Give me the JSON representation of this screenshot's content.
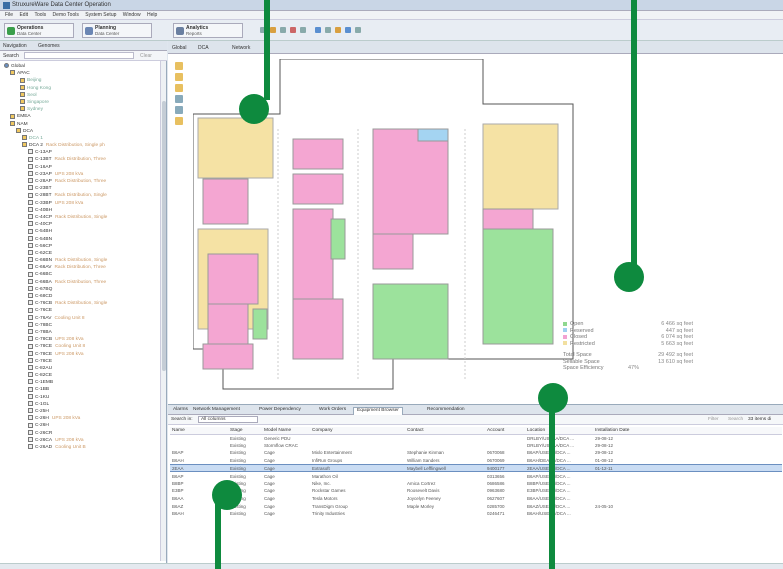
{
  "window": {
    "title": "StruxureWare Data Center Operation"
  },
  "menu": [
    "File",
    "Edit",
    "Tools",
    "Demo Tools",
    "System Setup",
    "Window",
    "Help"
  ],
  "perspectives": [
    {
      "title": "Operations",
      "subtitle": "Data Center"
    },
    {
      "title": "Planning",
      "subtitle": "Data Center"
    },
    {
      "title": "Analytics",
      "subtitle": "Reports"
    }
  ],
  "left_tabs": [
    "Navigation",
    "Genomes"
  ],
  "search_label": "Search",
  "clear_label": "Clear",
  "tree": [
    {
      "label": "Global",
      "extra": "",
      "c": ""
    },
    {
      "label": "APAC",
      "extra": "",
      "c": ""
    },
    {
      "label": "Beijing",
      "extra": "",
      "c": "g"
    },
    {
      "label": "Hong Kong",
      "extra": "",
      "c": "g"
    },
    {
      "label": "Seol",
      "extra": "",
      "c": "g"
    },
    {
      "label": "Singapore",
      "extra": "",
      "c": "g"
    },
    {
      "label": "Sydney",
      "extra": "",
      "c": "g"
    },
    {
      "label": "EMEA",
      "extra": "",
      "c": ""
    },
    {
      "label": "NAM",
      "extra": "",
      "c": ""
    },
    {
      "label": "DCA",
      "extra": "",
      "c": ""
    },
    {
      "label": "DCA 1",
      "extra": "",
      "c": "g"
    },
    {
      "label": "DCA 2",
      "extra": "Rack Distribution, Single ph",
      "c": ""
    },
    {
      "label": "C-13AP",
      "extra": "",
      "c": ""
    },
    {
      "label": "C-13BT",
      "extra": "Rack Distribution, Three",
      "c": ""
    },
    {
      "label": "C-16AP",
      "extra": "",
      "c": ""
    },
    {
      "label": "C-23AP",
      "extra": "UPS 208 kVa",
      "c": ""
    },
    {
      "label": "C-28AP",
      "extra": "Rack Distribution, Three",
      "c": ""
    },
    {
      "label": "C-23BT",
      "extra": "",
      "c": ""
    },
    {
      "label": "C-28BT",
      "extra": "Rack Distribution, Single",
      "c": ""
    },
    {
      "label": "C-33BP",
      "extra": "UPS 208 kVa",
      "c": ""
    },
    {
      "label": "C-40BH",
      "extra": "",
      "c": ""
    },
    {
      "label": "C-44CP",
      "extra": "Rack Distribution, Single",
      "c": ""
    },
    {
      "label": "C-40CP",
      "extra": "",
      "c": ""
    },
    {
      "label": "C-54BH",
      "extra": "",
      "c": ""
    },
    {
      "label": "C-54BN",
      "extra": "",
      "c": ""
    },
    {
      "label": "C-56CP",
      "extra": "",
      "c": ""
    },
    {
      "label": "C-62CE",
      "extra": "",
      "c": ""
    },
    {
      "label": "C-66BN",
      "extra": "Rack Distribution, Single",
      "c": ""
    },
    {
      "label": "C-66AV",
      "extra": "Rack Distribution, Three",
      "c": ""
    },
    {
      "label": "C-66BC",
      "extra": "",
      "c": ""
    },
    {
      "label": "C-66BA",
      "extra": "Rack Distribution, Three",
      "c": ""
    },
    {
      "label": "C-67BQ",
      "extra": "",
      "c": ""
    },
    {
      "label": "C-68CD",
      "extra": "",
      "c": ""
    },
    {
      "label": "C-76CB",
      "extra": "Rack Distribution, Single",
      "c": ""
    },
    {
      "label": "C-76CE",
      "extra": "",
      "c": ""
    },
    {
      "label": "C-76AV",
      "extra": "Cooling Unit 8",
      "c": ""
    },
    {
      "label": "C-78BC",
      "extra": "",
      "c": ""
    },
    {
      "label": "C-78BA",
      "extra": "",
      "c": ""
    },
    {
      "label": "C-78CB",
      "extra": "UPS 208 kVa",
      "c": ""
    },
    {
      "label": "C-78CE",
      "extra": "Cooling Unit 8",
      "c": ""
    },
    {
      "label": "C-78CE",
      "extra": "UPS 208 kVa",
      "c": ""
    },
    {
      "label": "C-78CE",
      "extra": "",
      "c": ""
    },
    {
      "label": "C-82AU",
      "extra": "",
      "c": ""
    },
    {
      "label": "C-82CE",
      "extra": "",
      "c": ""
    },
    {
      "label": "C-1EMB",
      "extra": "",
      "c": ""
    },
    {
      "label": "C-1BB",
      "extra": "",
      "c": ""
    },
    {
      "label": "C-1KU",
      "extra": "",
      "c": ""
    },
    {
      "label": "C-1GL",
      "extra": "",
      "c": ""
    },
    {
      "label": "C-25H",
      "extra": "",
      "c": ""
    },
    {
      "label": "C-26H",
      "extra": "UPS 208 kVa",
      "c": ""
    },
    {
      "label": "C-26H",
      "extra": "",
      "c": ""
    },
    {
      "label": "C-26CR",
      "extra": "",
      "c": ""
    },
    {
      "label": "C-26CA",
      "extra": "UPS 208 kVa",
      "c": ""
    },
    {
      "label": "C-26AD",
      "extra": "Cooling Unit B",
      "c": ""
    }
  ],
  "doc_tabs": [
    "Global",
    "DCA",
    "Network"
  ],
  "legend": [
    {
      "label": "Open",
      "value": "6 466 sq feet",
      "color": "#8fd88f"
    },
    {
      "label": "Reserved",
      "value": "447 sq feet",
      "color": "#9fd0f0"
    },
    {
      "label": "Closed",
      "value": "6 074 sq feet",
      "color": "#f2a2d2"
    },
    {
      "label": "Restricted",
      "value": "5 663 sq feet",
      "color": "#f2e0a0"
    }
  ],
  "totals": [
    {
      "label": "Total Space",
      "value": "29 492 sq feet"
    },
    {
      "label": "Sellable Space",
      "value": "13 610 sq feet"
    },
    {
      "label": "Space Efficiency",
      "value": "47%"
    }
  ],
  "bottom_tabs": [
    "Alarms",
    "Network Management",
    "Power Dependency",
    "Work Orders",
    "Equipment Browser",
    "Recommendation"
  ],
  "search_in": {
    "label": "Search in:",
    "value": "All columns",
    "filter": "Filter",
    "search": "Search",
    "count": "33 items di"
  },
  "table": {
    "headers": [
      "Name",
      "Stage",
      "Model Name",
      "Company",
      "Contact",
      "Account",
      "Location",
      "Installation Date"
    ],
    "rows": [
      [
        "",
        "Existing",
        "Generic PDU",
        "",
        "",
        "",
        "DRLBY/USEAA/DCA ...",
        "29-08-12"
      ],
      [
        "",
        "Existing",
        "Stormflow CRAC",
        "",
        "",
        "",
        "DRLBY/USEAA/DCA ...",
        "29-08-12"
      ],
      [
        "B6AP",
        "Existing",
        "Cage",
        "Mixlo Entertainment",
        "Stephanie Kinman",
        "0670068",
        "B6AP/USEAA/DCA ...",
        "29-08-12"
      ],
      [
        "B6AH",
        "Existing",
        "Cage",
        "InfiRun Groups",
        "William Sanders",
        "0670069",
        "B6AH/DEAAA/DCA ...",
        "01-08-12"
      ],
      [
        "2EAA",
        "Existing",
        "Cage",
        "Extrasoft",
        "Maybell Lefflingwell",
        "9400177",
        "2EAA/USEAA/DCA ...",
        "01-12-11"
      ],
      [
        "B6AP",
        "Existing",
        "Cage",
        "Marathon Oil",
        "",
        "0313656",
        "B6AP/USEAA/DCA ...",
        ""
      ],
      [
        "B8BP",
        "Existing",
        "Cage",
        "Nike, Inc.",
        "Amica Cortrez",
        "0686586",
        "B8BP/USEAA/DCA ...",
        ""
      ],
      [
        "E3BP",
        "Existing",
        "Cage",
        "Rockstar Games",
        "Roosevelt Davis",
        "0963680",
        "E3BP/USEAA/DCA ...",
        ""
      ],
      [
        "B6AA",
        "Existing",
        "Cage",
        "Tesla Motors",
        "Joycelyn Feeney",
        "0627607",
        "B6AA/USEAA/DCA ...",
        ""
      ],
      [
        "B6AZ",
        "Existing",
        "Cage",
        "TransDigm Group",
        "Maple Morley",
        "0285700",
        "B6AZ/USEAA/DCA ...",
        "24-05-10"
      ],
      [
        "B6AH",
        "Existing",
        "Cage",
        "Trinity Industries",
        "",
        "0246471",
        "B6AH/USEAA/DCA ...",
        ""
      ]
    ],
    "selected": 4
  }
}
